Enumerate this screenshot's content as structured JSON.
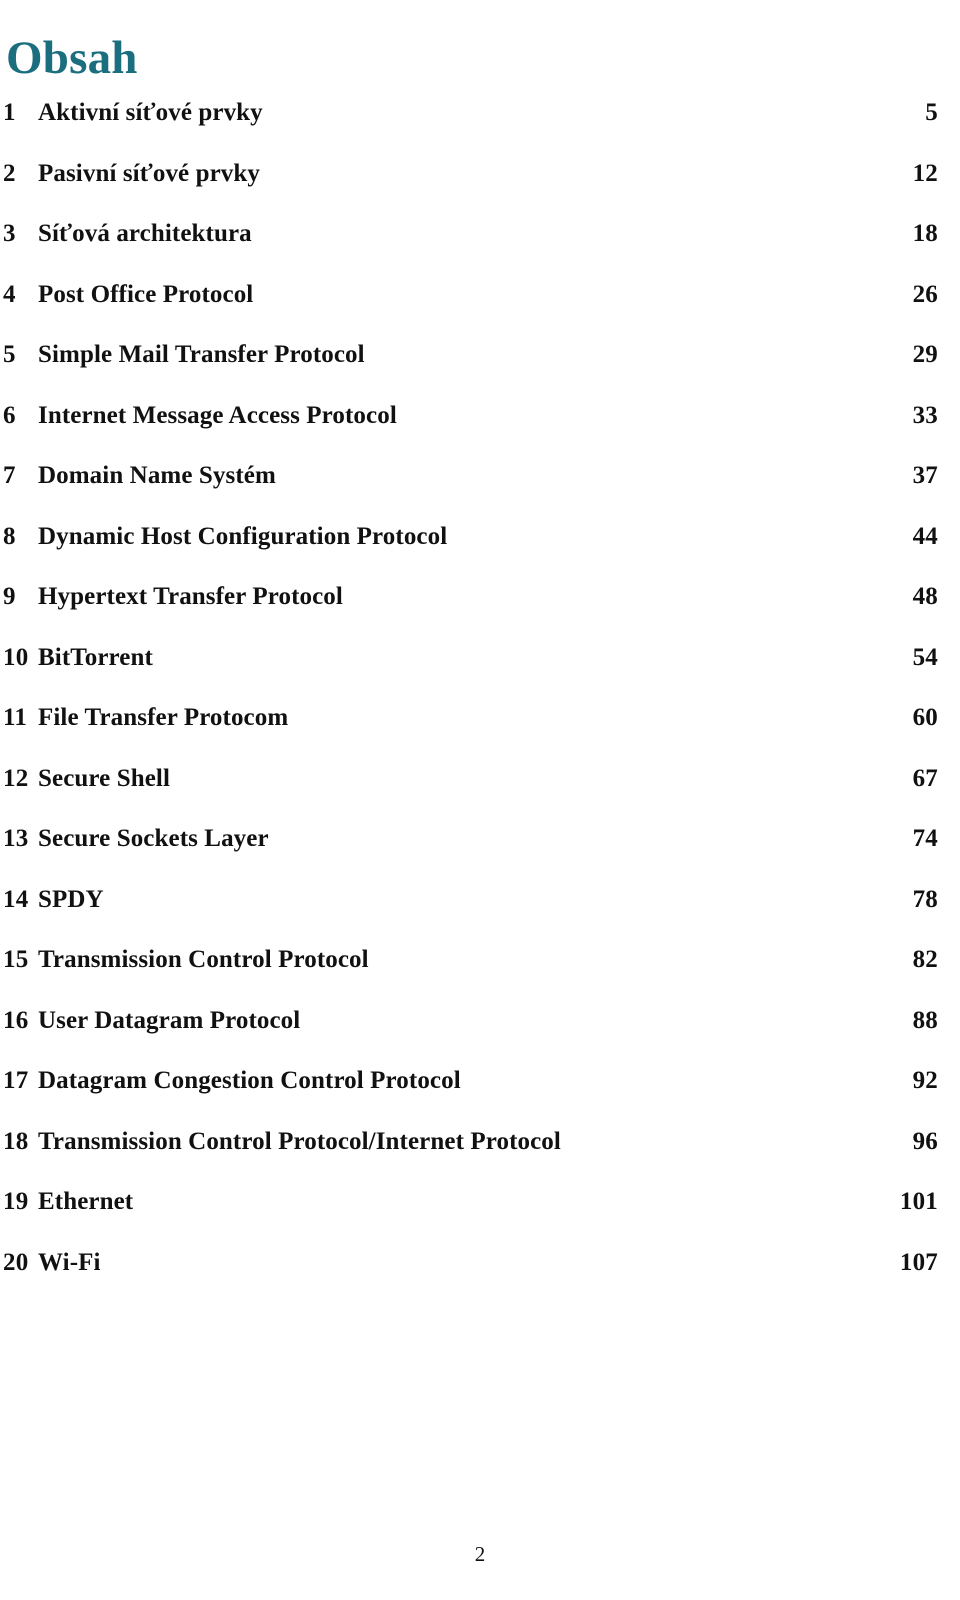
{
  "document": {
    "title": "Obsah",
    "footer_page_number": "2",
    "accent_color": "#1a6e7e",
    "text_color": "#111111",
    "background_color": "#ffffff"
  },
  "toc": {
    "entries": [
      {
        "number": "1",
        "title": "Aktivní síťové prvky",
        "page": "5"
      },
      {
        "number": "2",
        "title": "Pasivní síťové prvky",
        "page": "12"
      },
      {
        "number": "3",
        "title": "Síťová architektura",
        "page": "18"
      },
      {
        "number": "4",
        "title": "Post Office Protocol",
        "page": "26"
      },
      {
        "number": "5",
        "title": "Simple Mail Transfer Protocol",
        "page": "29"
      },
      {
        "number": "6",
        "title": "Internet Message Access Protocol",
        "page": "33"
      },
      {
        "number": "7",
        "title": "Domain Name Systém",
        "page": "37"
      },
      {
        "number": "8",
        "title": "Dynamic Host Configuration Protocol",
        "page": "44"
      },
      {
        "number": "9",
        "title": "Hypertext Transfer Protocol",
        "page": "48"
      },
      {
        "number": "10",
        "title": "BitTorrent",
        "page": "54"
      },
      {
        "number": "11",
        "title": "File Transfer Protocom",
        "page": "60"
      },
      {
        "number": "12",
        "title": "Secure Shell",
        "page": "67"
      },
      {
        "number": "13",
        "title": "Secure Sockets Layer",
        "page": "74"
      },
      {
        "number": "14",
        "title": "SPDY",
        "page": "78"
      },
      {
        "number": "15",
        "title": "Transmission Control Protocol",
        "page": "82"
      },
      {
        "number": "16",
        "title": "User Datagram Protocol",
        "page": "88"
      },
      {
        "number": "17",
        "title": "Datagram Congestion Control Protocol",
        "page": "92"
      },
      {
        "number": "18",
        "title": "Transmission Control Protocol/Internet Protocol",
        "page": "96"
      },
      {
        "number": "19",
        "title": "Ethernet",
        "page": "101"
      },
      {
        "number": "20",
        "title": "Wi-Fi",
        "page": "107"
      }
    ]
  }
}
